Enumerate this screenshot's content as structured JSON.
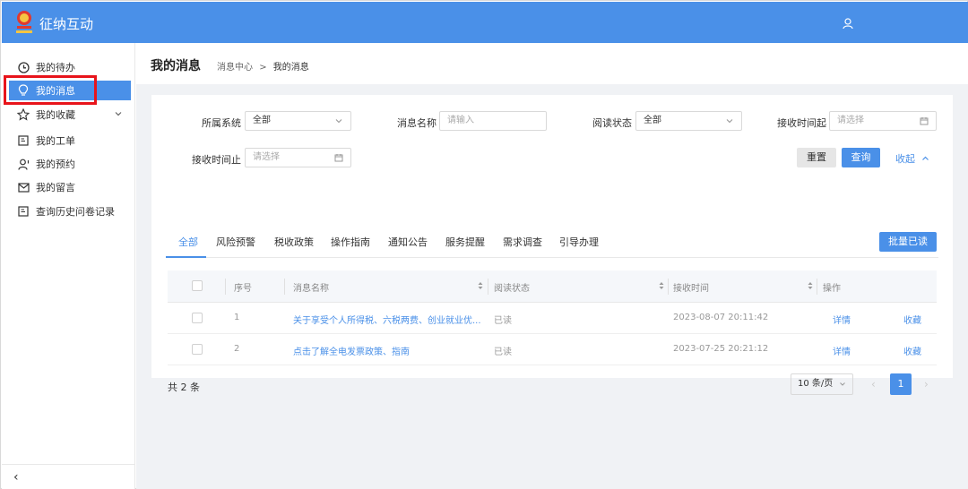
{
  "header": {
    "app_title": "征纳互动",
    "logo_icon": "tax-emblem-icon",
    "user_icon": "user-icon"
  },
  "sidebar": {
    "items": [
      {
        "label": "我的待办",
        "icon": "clock-icon"
      },
      {
        "label": "我的消息",
        "icon": "lightbulb-icon",
        "active": true
      },
      {
        "label": "我的收藏",
        "icon": "star-icon",
        "expandable": true
      },
      {
        "label": "我的工单",
        "icon": "document-icon"
      },
      {
        "label": "我的预约",
        "icon": "person-icon"
      },
      {
        "label": "我的留言",
        "icon": "mail-icon"
      },
      {
        "label": "查询历史问卷记录",
        "icon": "list-icon"
      }
    ],
    "collapse_label": "‹"
  },
  "page": {
    "title": "我的消息",
    "breadcrumb": {
      "parent": "消息中心",
      "separator": ">",
      "current": "我的消息"
    }
  },
  "filters": {
    "system": {
      "label": "所属系统",
      "value": "全部"
    },
    "message_name": {
      "label": "消息名称",
      "placeholder": "请输入"
    },
    "read_status": {
      "label": "阅读状态",
      "value": "全部"
    },
    "receive_start": {
      "label": "接收时间起",
      "placeholder": "请选择"
    },
    "receive_end": {
      "label": "接收时间止",
      "placeholder": "请选择"
    },
    "reset_label": "重置",
    "query_label": "查询",
    "collapse_label": "收起"
  },
  "tabs": [
    "全部",
    "风险预警",
    "税收政策",
    "操作指南",
    "通知公告",
    "服务提醒",
    "需求调查",
    "引导办理"
  ],
  "active_tab": "全部",
  "batch_read_label": "批量已读",
  "table": {
    "columns": [
      "序号",
      "消息名称",
      "阅读状态",
      "接收时间",
      "操作"
    ],
    "rows": [
      {
        "index": "1",
        "name": "关于享受个人所得税、六税两费、创业就业优...",
        "status": "已读",
        "time": "2023-08-07 20:11:42",
        "detail": "详情",
        "favorite": "收藏"
      },
      {
        "index": "2",
        "name": "点击了解全电发票政策、指南",
        "status": "已读",
        "time": "2023-07-25 20:21:12",
        "detail": "详情",
        "favorite": "收藏"
      }
    ]
  },
  "pagination": {
    "total_text": "共 2 条",
    "page_size": "10 条/页",
    "prev": "‹",
    "current_page": "1",
    "next": "›"
  },
  "colors": {
    "primary": "#4a90e8",
    "highlight_box": "#e8141b",
    "main_bg": "#f0f2f5"
  }
}
